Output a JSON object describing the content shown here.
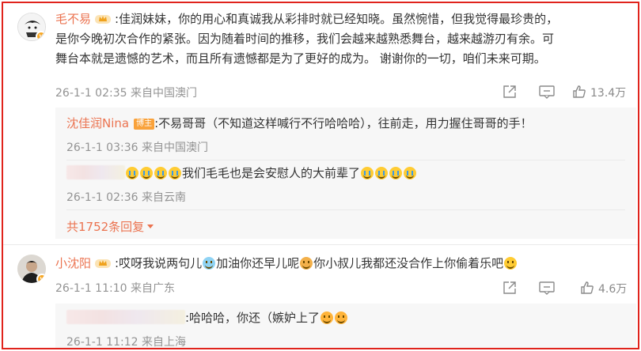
{
  "comments": [
    {
      "user": "毛不易",
      "text": ":佳润妹妹，你的用心和真诚我从彩排时就已经知晓。虽然惋惜，但我觉得最珍贵的，是你今晚初次合作的紧张。因为随着时间的推移，我们会越来越熟悉舞台，越来越游刃有余。可舞台本就是遗憾的艺术，而且所有遗憾都是为了更好的成为。 谢谢你的一切，咱们未来可期。",
      "line1": ":佳润妹妹，你的用心和真诚我从彩排时就已经知晓。虽然惋惜，但我觉得最珍贵的，",
      "line2": "是你今晚初次合作的紧张。因为随着时间的推移，我们会越来越熟悉舞台，越来越游刃有余。可",
      "line3": "舞台本就是遗憾的艺术，而且所有遗憾都是为了更好的成为。 谢谢你的一切，咱们未来可期。",
      "meta": "26-1-1 02:35 来自中国澳门",
      "likes": "13.4万",
      "replies": [
        {
          "user": "沈佳润Nina",
          "badge": "博主",
          "text": ":不易哥哥（不知道这样喊行不行哈哈哈），往前走，用力握住哥哥的手！",
          "meta": "26-1-1 03:36 来自中国澳门"
        },
        {
          "user": "",
          "text": "我们毛毛也是会安慰人的大前辈了",
          "meta": "26-1-1 02:36 来自云南"
        }
      ],
      "more_replies": "共1752条回复"
    },
    {
      "user": "小沈阳",
      "text_a": ":哎呀我说两句儿",
      "text_b": "加油你还早儿呢",
      "text_c": "你小叔儿我都还没合作上你偷着乐吧",
      "meta": "26-1-1 11:10 来自广东",
      "likes": "4.6万",
      "replies": [
        {
          "user": "",
          "text": ":哈哈哈，你还（嫉妒上了",
          "meta": "26-1-1 11:12 来自上海"
        }
      ]
    }
  ],
  "colors": {
    "name": "#eb7350",
    "frame": "#e0231c",
    "meta": "#939393"
  },
  "icons": [
    "share-icon",
    "comment-icon",
    "like-icon",
    "crown-badge-icon",
    "verified-badge-icon"
  ]
}
